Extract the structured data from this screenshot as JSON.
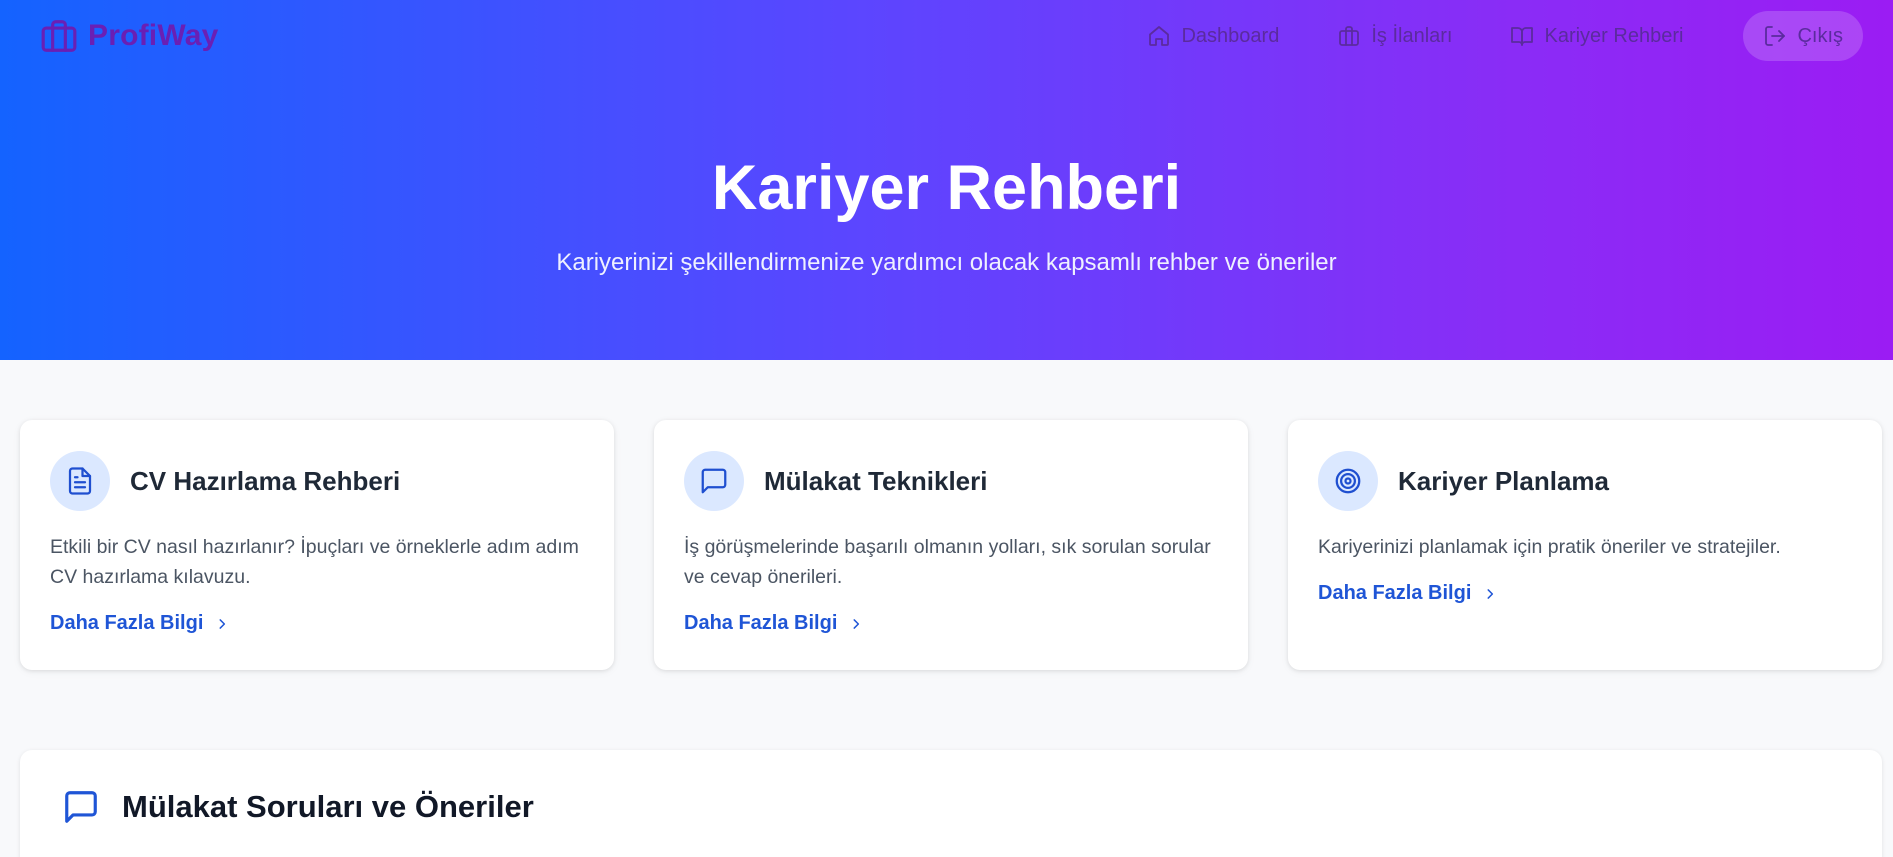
{
  "brand": {
    "name": "ProfiWay",
    "icon": "briefcase-icon",
    "color": "#6a1fb4"
  },
  "nav": {
    "items": [
      {
        "label": "Dashboard",
        "icon": "home-icon"
      },
      {
        "label": "İş İlanları",
        "icon": "briefcase-icon"
      },
      {
        "label": "Kariyer Rehberi",
        "icon": "book-open-icon"
      }
    ],
    "logout": {
      "label": "Çıkış",
      "icon": "logout-icon"
    }
  },
  "hero": {
    "title": "Kariyer Rehberi",
    "subtitle": "Kariyerinizi şekillendirmenize yardımcı olacak kapsamlı rehber ve öneriler",
    "gradient": [
      "#1463ff",
      "#9b1cf3"
    ]
  },
  "cards": [
    {
      "title": "CV Hazırlama Rehberi",
      "icon": "document-icon",
      "description": "Etkili bir CV nasıl hazırlanır? İpuçları ve örneklerle adım adım CV hazırlama kılavuzu.",
      "link": "Daha Fazla Bilgi"
    },
    {
      "title": "Mülakat Teknikleri",
      "icon": "chat-icon",
      "description": "İş görüşmelerinde başarılı olmanın yolları, sık sorulan sorular ve cevap önerileri.",
      "link": "Daha Fazla Bilgi"
    },
    {
      "title": "Kariyer Planlama",
      "icon": "target-icon",
      "description": "Kariyerinizi planlamak için pratik öneriler ve stratejiler.",
      "link": "Daha Fazla Bilgi"
    }
  ],
  "section": {
    "title": "Mülakat Soruları ve Öneriler",
    "icon": "chat-icon"
  },
  "colors": {
    "accent": "#1f55d6",
    "icon_bg": "#dbe8ff",
    "page_bg": "#f8f9fb"
  }
}
